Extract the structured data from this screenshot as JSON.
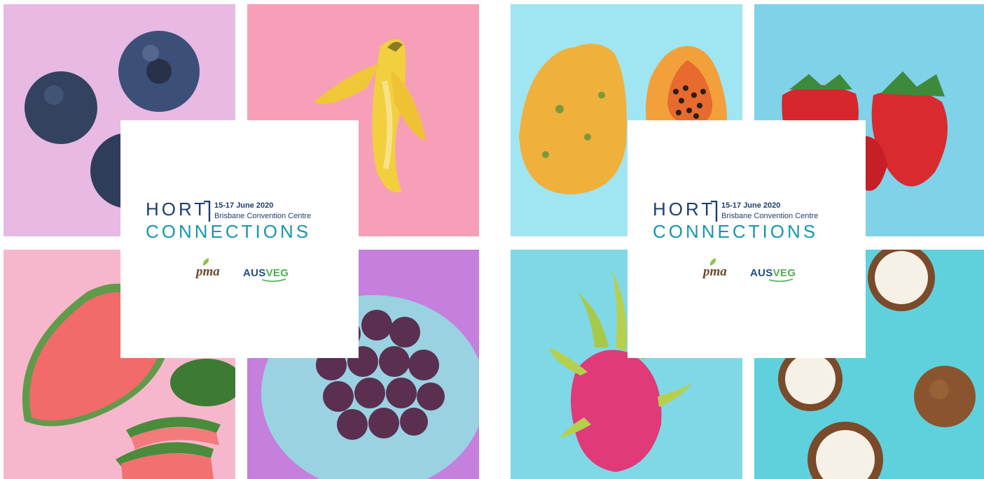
{
  "event": {
    "word_line1": "HORT",
    "word_line2": "CONNECTIONS",
    "date": "15-17 June 2020",
    "venue": "Brisbane Convention Centre"
  },
  "sponsors": {
    "pma": "pma",
    "ausveg_part1": "AUS",
    "ausveg_part2": "VEG"
  },
  "panels": [
    {
      "tiles": [
        "blueberries",
        "banana",
        "watermelon",
        "plums"
      ]
    },
    {
      "tiles": [
        "papaya",
        "strawberries",
        "dragon-fruit",
        "coconut"
      ]
    }
  ],
  "colors": {
    "navy": "#1c3f6e",
    "teal": "#1796b0",
    "pma_brown": "#6b4a2b",
    "ausveg_blue": "#1c4e8c",
    "ausveg_green": "#4caf50"
  }
}
